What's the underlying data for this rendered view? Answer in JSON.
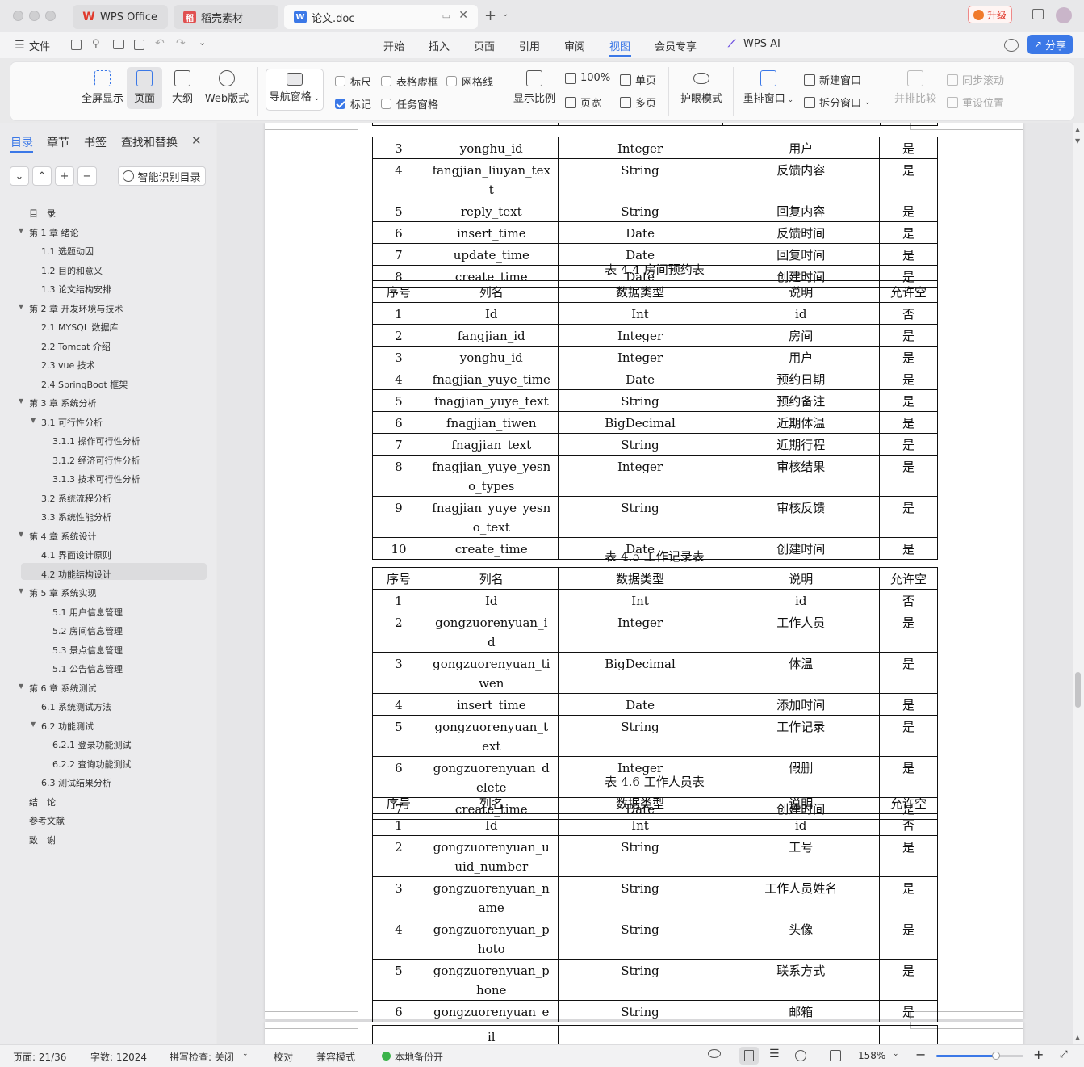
{
  "tabs": [
    {
      "label": "WPS Office"
    },
    {
      "label": "稻壳素材"
    },
    {
      "label": "论文.doc"
    }
  ],
  "upgrade": "升级",
  "file_menu": "文件",
  "menus": [
    "开始",
    "插入",
    "页面",
    "引用",
    "审阅",
    "视图",
    "会员专享"
  ],
  "active_menu": "视图",
  "wps_ai": "WPS AI",
  "share": "分享",
  "ribbon": {
    "fullscreen": "全屏显示",
    "page": "页面",
    "outline": "大纲",
    "web": "Web版式",
    "nav_pane": "导航窗格",
    "ruler": "标尺",
    "table_grid": "表格虚框",
    "gridlines": "网格线",
    "marks": "标记",
    "task_pane": "任务窗格",
    "zoom_ratio": "显示比例",
    "hundred": "100%",
    "page_width": "页宽",
    "single_page": "单页",
    "multi_page": "多页",
    "eye_mode": "护眼模式",
    "rearrange": "重排窗口",
    "new_window": "新建窗口",
    "split_window": "拆分窗口",
    "compare": "并排比较",
    "sync_scroll": "同步滚动",
    "reset_pos": "重设位置"
  },
  "panel": {
    "tabs": [
      "目录",
      "章节",
      "书签",
      "查找和替换"
    ],
    "smart_toc": "智能识别目录",
    "toc": [
      {
        "text": "目　录",
        "level": 0,
        "arrow": false
      },
      {
        "text": "第 1 章  绪论",
        "level": 0,
        "arrow": true
      },
      {
        "text": "1.1 选题动因",
        "level": 1,
        "arrow": false
      },
      {
        "text": "1.2 目的和意义",
        "level": 1,
        "arrow": false
      },
      {
        "text": "1.3 论文结构安排",
        "level": 1,
        "arrow": false
      },
      {
        "text": "第 2 章  开发环境与技术",
        "level": 0,
        "arrow": true
      },
      {
        "text": "2.1 MYSQL 数据库",
        "level": 1,
        "arrow": false
      },
      {
        "text": "2.2 Tomcat  介绍",
        "level": 1,
        "arrow": false
      },
      {
        "text": "2.3 vue 技术",
        "level": 1,
        "arrow": false
      },
      {
        "text": "2.4 SpringBoot 框架",
        "level": 1,
        "arrow": false
      },
      {
        "text": "第 3 章  系统分析",
        "level": 0,
        "arrow": true
      },
      {
        "text": "3.1 可行性分析",
        "level": 1,
        "arrow": true
      },
      {
        "text": "3.1.1 操作可行性分析",
        "level": 2,
        "arrow": false
      },
      {
        "text": "3.1.2 经济可行性分析",
        "level": 2,
        "arrow": false
      },
      {
        "text": "3.1.3 技术可行性分析",
        "level": 2,
        "arrow": false
      },
      {
        "text": "3.2 系统流程分析",
        "level": 1,
        "arrow": false
      },
      {
        "text": "3.3 系统性能分析",
        "level": 1,
        "arrow": false
      },
      {
        "text": "第 4 章  系统设计",
        "level": 0,
        "arrow": true
      },
      {
        "text": "4.1 界面设计原则",
        "level": 1,
        "arrow": false
      },
      {
        "text": "4.2 功能结构设计",
        "level": 1,
        "arrow": false,
        "selected": true
      },
      {
        "text": "第 5 章  系统实现",
        "level": 0,
        "arrow": true
      },
      {
        "text": "5.1 用户信息管理",
        "level": 2,
        "arrow": false
      },
      {
        "text": "5.2  房间信息管理",
        "level": 2,
        "arrow": false
      },
      {
        "text": "5.3 景点信息管理",
        "level": 2,
        "arrow": false
      },
      {
        "text": "5.1 公告信息管理",
        "level": 2,
        "arrow": false
      },
      {
        "text": "第 6 章  系统测试",
        "level": 0,
        "arrow": true
      },
      {
        "text": "6.1  系统测试方法",
        "level": 1,
        "arrow": false
      },
      {
        "text": "6.2  功能测试",
        "level": 1,
        "arrow": true
      },
      {
        "text": "6.2.1  登录功能测试",
        "level": 2,
        "arrow": false
      },
      {
        "text": "6.2.2  查询功能测试",
        "level": 2,
        "arrow": false
      },
      {
        "text": "6.3  测试结果分析",
        "level": 1,
        "arrow": false
      },
      {
        "text": "结　论",
        "level": 0,
        "arrow": false
      },
      {
        "text": "参考文献",
        "level": 0,
        "arrow": false
      },
      {
        "text": "致　谢",
        "level": 0,
        "arrow": false
      }
    ]
  },
  "doc": {
    "header_row": [
      "序号",
      "列名",
      "数据类型",
      "说明",
      "允许空"
    ],
    "t0_rows": [
      [
        "3",
        "yonghu_id",
        "Integer",
        "用户",
        "是"
      ],
      [
        "4",
        "fangjian_liuyan_text",
        "String",
        "反馈内容",
        "是"
      ],
      [
        "5",
        "reply_text",
        "String",
        "回复内容",
        "是"
      ],
      [
        "6",
        "insert_time",
        "Date",
        "反馈时间",
        "是"
      ],
      [
        "7",
        "update_time",
        "Date",
        "回复时间",
        "是"
      ],
      [
        "8",
        "create_time",
        "Date",
        "创建时间",
        "是"
      ]
    ],
    "t1_caption": "表 4.4 房间预约表",
    "t1_rows": [
      [
        "1",
        "Id",
        "Int",
        "id",
        "否"
      ],
      [
        "2",
        "fangjian_id",
        "Integer",
        "房间",
        "是"
      ],
      [
        "3",
        "yonghu_id",
        "Integer",
        "用户",
        "是"
      ],
      [
        "4",
        "fnagjian_yuye_time",
        "Date",
        "预约日期",
        "是"
      ],
      [
        "5",
        "fnagjian_yuye_text",
        "String",
        "预约备注",
        "是"
      ],
      [
        "6",
        "fnagjian_tiwen",
        "BigDecimal",
        "近期体温",
        "是"
      ],
      [
        "7",
        "fnagjian_text",
        "String",
        "近期行程",
        "是"
      ],
      [
        "8",
        "fnagjian_yuye_yesno_types",
        "Integer",
        "审核结果",
        "是"
      ],
      [
        "9",
        "fnagjian_yuye_yesno_text",
        "String",
        "审核反馈",
        "是"
      ],
      [
        "10",
        "create_time",
        "Date",
        "创建时间",
        "是"
      ]
    ],
    "t2_caption": "表 4.5 工作记录表",
    "t2_rows": [
      [
        "1",
        "Id",
        "Int",
        "id",
        "否"
      ],
      [
        "2",
        "gongzuorenyuan_id",
        "Integer",
        "工作人员",
        "是"
      ],
      [
        "3",
        "gongzuorenyuan_tiwen",
        "BigDecimal",
        "体温",
        "是"
      ],
      [
        "4",
        "insert_time",
        "Date",
        "添加时间",
        "是"
      ],
      [
        "5",
        "gongzuorenyuan_text",
        "String",
        "工作记录",
        "是"
      ],
      [
        "6",
        "gongzuorenyuan_delete",
        "Integer",
        "假删",
        "是"
      ],
      [
        "7",
        "create_time",
        "Date",
        "创建时间",
        "是"
      ]
    ],
    "t3_caption": "表 4.6 工作人员表",
    "t3_rows": [
      [
        "1",
        "Id",
        "Int",
        "id",
        "否"
      ],
      [
        "2",
        "gongzuorenyuan_uuid_number",
        "String",
        "工号",
        "是"
      ],
      [
        "3",
        "gongzuorenyuan_name",
        "String",
        "工作人员姓名",
        "是"
      ],
      [
        "4",
        "gongzuorenyuan_photo",
        "String",
        "头像",
        "是"
      ],
      [
        "5",
        "gongzuorenyuan_phone",
        "String",
        "联系方式",
        "是"
      ],
      [
        "6",
        "gongzuorenyuan_ema",
        "String",
        "邮箱",
        "是"
      ]
    ],
    "t4_rows": [
      [
        "",
        "il",
        "",
        "",
        ""
      ]
    ]
  },
  "status": {
    "page": "页面: 21/36",
    "words": "字数: 12024",
    "spell": "拼写检查: 关闭",
    "proof": "校对",
    "compat": "兼容模式",
    "backup": "本地备份开",
    "zoom": "158%"
  }
}
